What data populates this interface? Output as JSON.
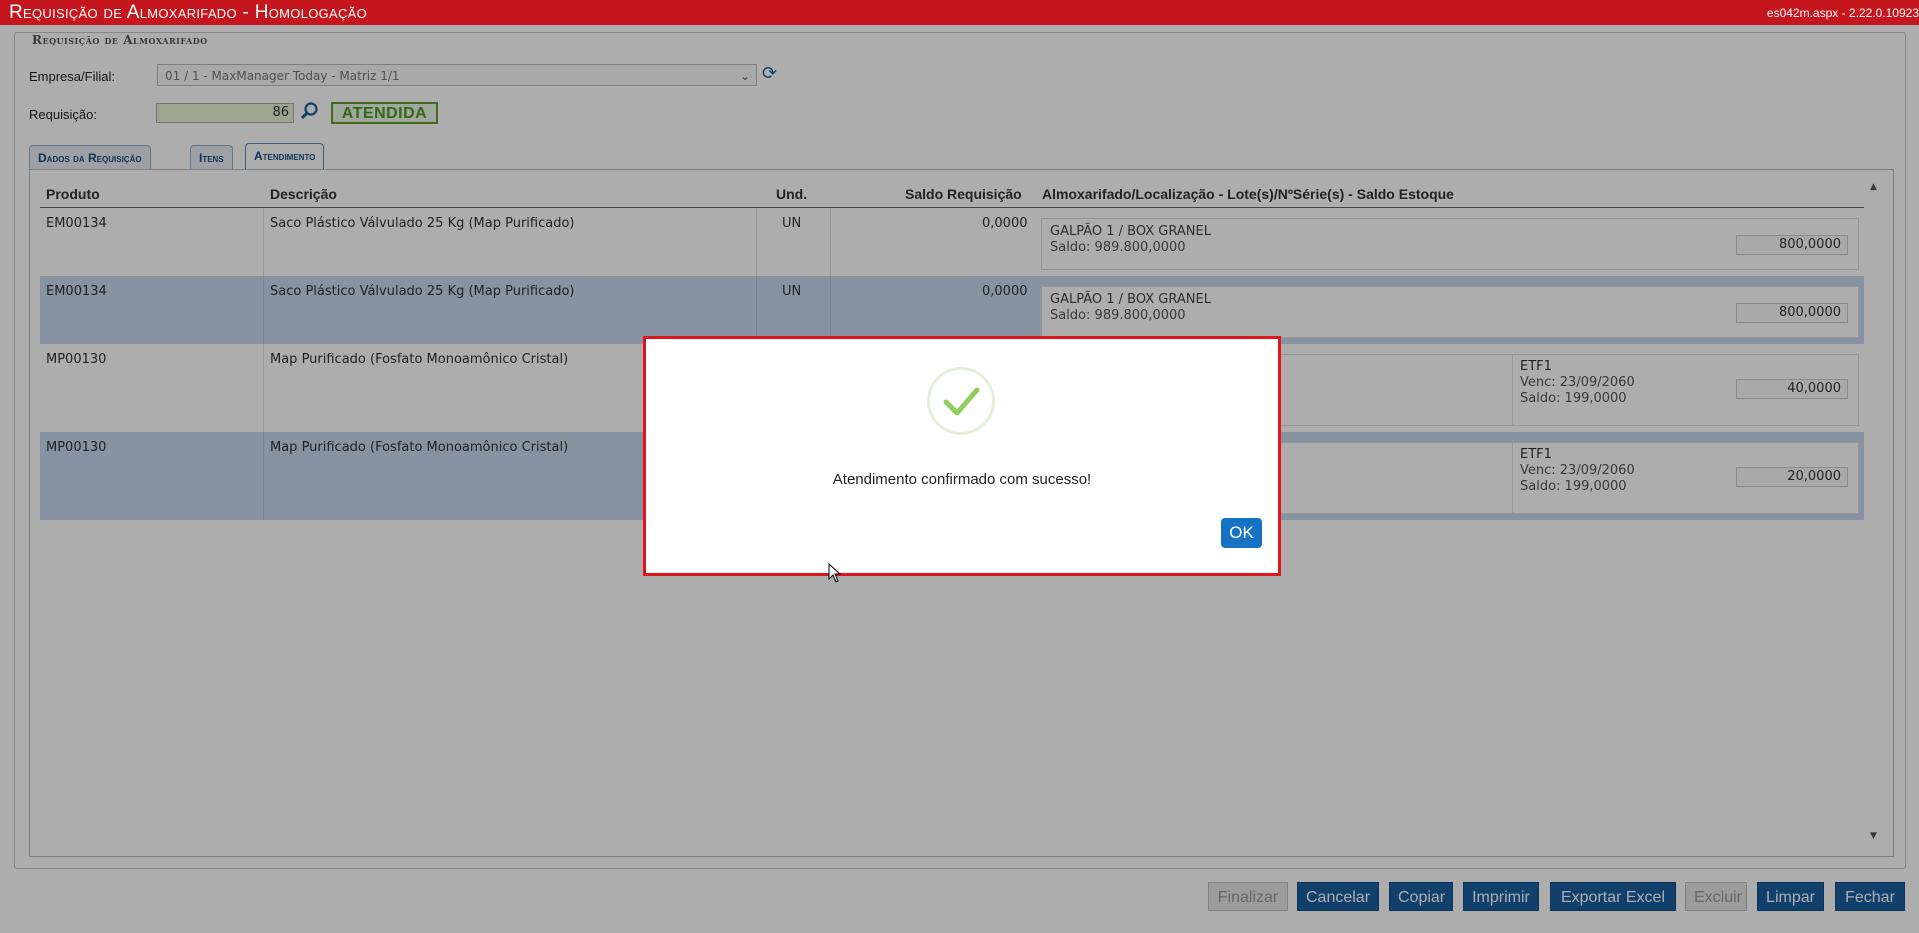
{
  "window": {
    "title": "Requisição de Almoxarifado  - Homologação",
    "version": "es042m.aspx - 2.22.0.10923"
  },
  "form": {
    "section_title": "Requisição de Almoxarifado",
    "empresa_label": "Empresa/Filial:",
    "empresa_value": "01 / 1 - MaxManager Today - Matriz 1/1",
    "requisicao_label": "Requisição:",
    "requisicao_value": "86",
    "status": "ATENDIDA"
  },
  "tabs": [
    {
      "label": "Dados da Requisição",
      "active": false
    },
    {
      "label": "Itens",
      "active": false
    },
    {
      "label": "Atendimento",
      "active": true
    }
  ],
  "table": {
    "headers": [
      "Produto",
      "Descrição",
      "Und.",
      "Saldo Requisição",
      "Almoxarifado/Localização - Lote(s)/NºSérie(s) - Saldo Estoque"
    ],
    "rows": [
      {
        "produto": "EM00134",
        "descricao": "Saco Plástico Válvulado 25 Kg (Map Purificado)",
        "und": "UN",
        "saldo": "0,0000",
        "local": "GALPÃO 1 / BOX GRANEL",
        "local_saldo": "Saldo: 989.800,0000",
        "lote": "",
        "lote_venc": "",
        "lote_saldo": "",
        "qty": "800,0000"
      },
      {
        "produto": "EM00134",
        "descricao": "Saco Plástico Válvulado 25 Kg (Map Purificado)",
        "und": "UN",
        "saldo": "0,0000",
        "local": "GALPÃO 1 / BOX GRANEL",
        "local_saldo": "Saldo: 989.800,0000",
        "lote": "",
        "lote_venc": "",
        "lote_saldo": "",
        "qty": "800,0000"
      },
      {
        "produto": "MP00130",
        "descricao": "Map Purificado (Fosfato Monoamônico Cristal)",
        "und": "",
        "saldo": "",
        "local": "",
        "local_saldo": "",
        "lote": "ETF1",
        "lote_venc": "Venc: 23/09/2060",
        "lote_saldo": "Saldo: 199,0000",
        "qty": "40,0000"
      },
      {
        "produto": "MP00130",
        "descricao": "Map Purificado (Fosfato Monoamônico Cristal)",
        "und": "",
        "saldo": "",
        "local": "",
        "local_saldo": "",
        "lote": "ETF1",
        "lote_venc": "Venc: 23/09/2060",
        "lote_saldo": "Saldo: 199,0000",
        "qty": "20,0000"
      }
    ]
  },
  "dialog": {
    "message": "Atendimento confirmado com sucesso!",
    "ok_label": "OK",
    "icon": "check-icon"
  },
  "buttons": {
    "finalizar": "Finalizar",
    "cancelar": "Cancelar",
    "copiar": "Copiar",
    "imprimir": "Imprimir",
    "exportar": "Exportar Excel",
    "excluir": "Excluir",
    "limpar": "Limpar",
    "fechar": "Fechar"
  },
  "colors": {
    "titlebar": "#c4161c",
    "button": "#1a5fa0",
    "status": "#4d9a22",
    "row_highlight": "#c7d9ee"
  }
}
